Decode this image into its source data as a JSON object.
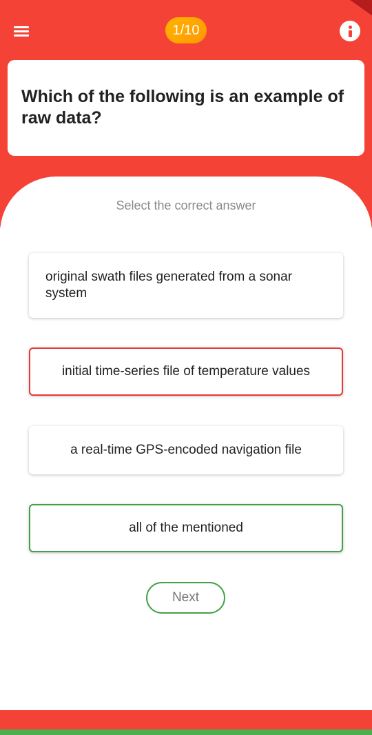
{
  "header": {
    "progress": "1/10",
    "menu_icon": "hamburger-menu-icon",
    "info_icon": "info-icon",
    "background_color": "#f44336"
  },
  "question": {
    "text": "Which of the following is an example of raw data?"
  },
  "instruction": "Select the correct answer",
  "options": [
    {
      "label": "original swath files generated from a sonar system",
      "state": "default"
    },
    {
      "label": "initial time-series file of temperature values",
      "state": "incorrect"
    },
    {
      "label": "a real-time GPS-encoded navigation file",
      "state": "default"
    },
    {
      "label": "all of the mentioned",
      "state": "correct"
    }
  ],
  "next_button": {
    "label": "Next"
  },
  "colors": {
    "accent_red": "#f44336",
    "incorrect_border": "#e53935",
    "correct_border": "#43a047",
    "progress_badge": "#ffb300"
  }
}
